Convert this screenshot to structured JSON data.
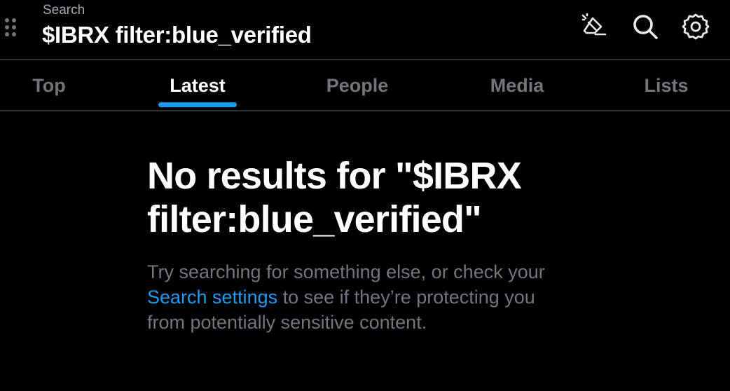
{
  "header": {
    "label": "Search",
    "query": "$IBRX filter:blue_verified",
    "icons": [
      "drag-handle-icon",
      "clear-search-icon",
      "search-icon",
      "settings-gear-icon"
    ]
  },
  "tabs": [
    {
      "label": "Top",
      "active": false
    },
    {
      "label": "Latest",
      "active": true
    },
    {
      "label": "People",
      "active": false
    },
    {
      "label": "Media",
      "active": false
    },
    {
      "label": "Lists",
      "active": false
    }
  ],
  "empty_state": {
    "title": "No results for \"$IBRX filter:blue_verified\"",
    "text_before": "Try searching for something else, or check your ",
    "link": "Search settings",
    "text_after": " to see if they’re protecting you from potentially sensitive content."
  },
  "colors": {
    "background": "#000000",
    "accent": "#1d9bf0",
    "muted": "#71767b",
    "divider": "#2f3336"
  }
}
